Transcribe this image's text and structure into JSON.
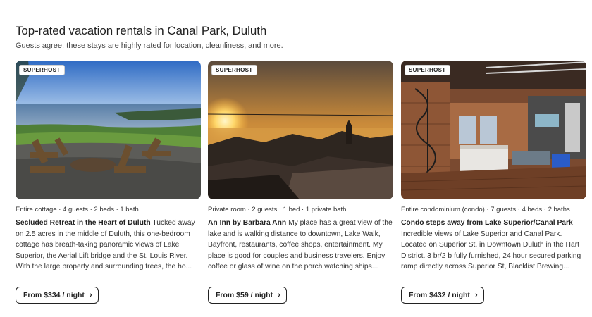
{
  "section": {
    "title": "Top-rated vacation rentals in Canal Park, Duluth",
    "subtitle": "Guests agree: these stays are highly rated for location, cleanliness, and more."
  },
  "listings": [
    {
      "badge": "SUPERHOST",
      "meta": "Entire cottage · 4 guests · 2 beds · 1 bath",
      "name": "Secluded Retreat in the Heart of Duluth",
      "description": "Tucked away on 2.5 acres in the middle of Duluth, this one-bedroom cottage has breath-taking panoramic views of Lake Superior, the Aerial Lift bridge and the St. Louis River. With the large property and surrounding trees, the ho...",
      "price_label": "From $334 / night",
      "chevron": "›"
    },
    {
      "badge": "SUPERHOST",
      "meta": "Private room · 2 guests · 1 bed · 1 private bath",
      "name": "An Inn by Barbara Ann",
      "description": "My place has a great view of the lake and is walking distance to downtown, Lake Walk, Bayfront, restaurants, coffee shops, entertainment. My place is good for couples and business travelers. Enjoy coffee or glass of wine on the porch watching ships...",
      "price_label": "From $59 / night",
      "chevron": "›"
    },
    {
      "badge": "SUPERHOST",
      "meta": "Entire condominium (condo) · 7 guests · 4 beds · 2 baths",
      "name": "Condo steps away from Lake Superior/Canal Park",
      "description": "Incredible views of Lake Superior and Canal Park. Located on Superior St. in Downtown Duluth in the Hart District. 3 br/2 b fully furnished, 24 hour secured parking ramp directly across Superior St, Blacklist Brewing...",
      "price_label": "From $432 / night",
      "chevron": "›"
    }
  ]
}
